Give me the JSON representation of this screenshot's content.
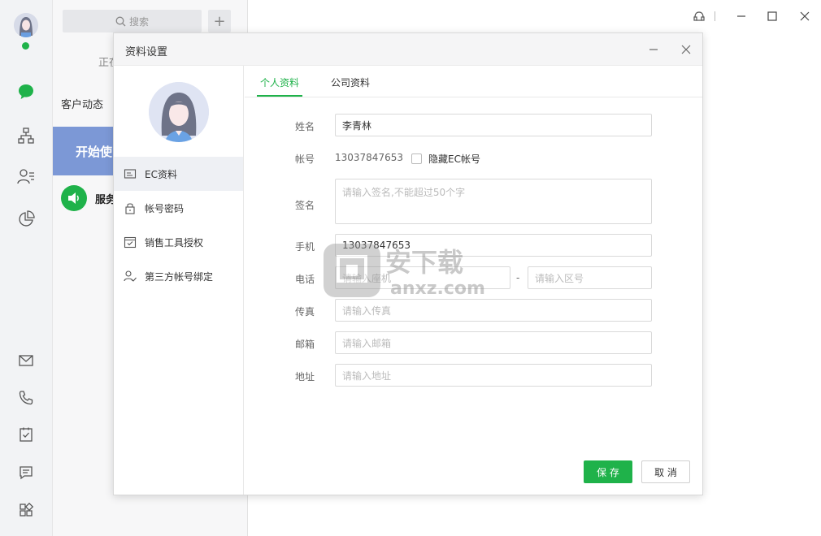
{
  "sidebar": {
    "icons": [
      "chat-icon",
      "org-chart-icon",
      "contacts-icon",
      "report-pie-icon",
      "mail-icon",
      "phone-icon",
      "task-icon",
      "message-icon",
      "apps-icon"
    ]
  },
  "list": {
    "search_placeholder": "搜索",
    "add_label": "+",
    "partial_status": "正在",
    "section_title": "客户动态",
    "banner_text": "开始使",
    "service_label": "服务"
  },
  "dialog": {
    "title": "资料设置",
    "side_menu": [
      {
        "label": "EC资料",
        "icon": "id-card-icon"
      },
      {
        "label": "帐号密码",
        "icon": "lock-icon"
      },
      {
        "label": "销售工具授权",
        "icon": "checkbox-calendar-icon"
      },
      {
        "label": "第三方帐号绑定",
        "icon": "user-check-icon"
      }
    ],
    "tabs": [
      {
        "label": "个人资料"
      },
      {
        "label": "公司资料"
      }
    ],
    "form": {
      "name_label": "姓名",
      "name_value": "李青林",
      "account_label": "帐号",
      "account_value": "13037847653",
      "hide_ec_label": "隐藏EC帐号",
      "signature_label": "签名",
      "signature_placeholder": "请输入签名,不能超过50个字",
      "mobile_label": "手机",
      "mobile_value": "13037847653",
      "phone_label": "电话",
      "phone_placeholder": "请输入座机",
      "phone_dash": "-",
      "area_placeholder": "请输入区号",
      "fax_label": "传真",
      "fax_placeholder": "请输入传真",
      "email_label": "邮箱",
      "email_placeholder": "请输入邮箱",
      "address_label": "地址",
      "address_placeholder": "请输入地址"
    },
    "buttons": {
      "save": "保 存",
      "cancel": "取 消"
    }
  },
  "watermark": {
    "text_cn": "安下载",
    "text_en": "anxz.com"
  },
  "colors": {
    "accent": "#1fb24a",
    "banner": "#7c98d6"
  }
}
